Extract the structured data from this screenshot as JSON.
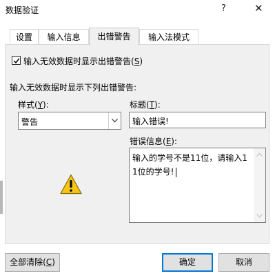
{
  "window": {
    "title": "数据验证",
    "help_symbol": "?",
    "close_symbol": "✕"
  },
  "tabs": [
    {
      "label": "设置",
      "active": false
    },
    {
      "label": "输入信息",
      "active": false
    },
    {
      "label": "出错警告",
      "active": true
    },
    {
      "label": "输入法模式",
      "active": false
    }
  ],
  "error_alert": {
    "show_checkbox": {
      "label_prefix": "输入无效数据时显示出错警告(",
      "hotkey": "S",
      "label_suffix": ")",
      "checked": true
    },
    "section_label": "输入无效数据时显示下列出错警告:",
    "style": {
      "label_prefix": "样式(",
      "hotkey": "Y",
      "label_suffix": "):",
      "value": "警告"
    },
    "title": {
      "label_prefix": "标题(",
      "hotkey": "T",
      "label_suffix": "):",
      "value": "输入错误!"
    },
    "message": {
      "label_prefix": "错误信息(",
      "hotkey": "E",
      "label_suffix": "):",
      "value": "输入的学号不是11位，请输入11位的学号!"
    },
    "icon": "warning-triangle-icon"
  },
  "buttons": {
    "clear": {
      "label_prefix": "全部清除(",
      "hotkey": "C",
      "label_suffix": ")"
    },
    "ok": "确定",
    "cancel": "取消"
  },
  "colors": {
    "default_button_border": "#0078d7",
    "panel_bg": "#f0f0f0",
    "warning_yellow": "#f5c518"
  }
}
